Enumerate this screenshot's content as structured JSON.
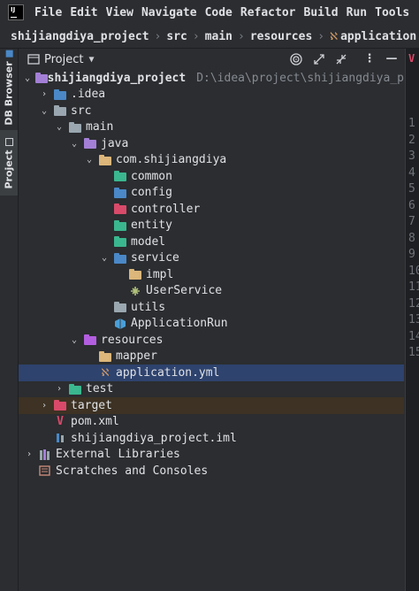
{
  "menu": [
    "File",
    "Edit",
    "View",
    "Navigate",
    "Code",
    "Refactor",
    "Build",
    "Run",
    "Tools"
  ],
  "breadcrumbs": [
    "shijiangdiya_project",
    "src",
    "main",
    "resources",
    "application.yml"
  ],
  "side_tabs": {
    "db_browser": "DB Browser",
    "project": "Project"
  },
  "panel": {
    "title": "Project"
  },
  "tree": {
    "root": "shijiangdiya_project",
    "root_path": "D:\\idea\\project\\shijiangdiya_p",
    "idea": ".idea",
    "src": "src",
    "main": "main",
    "java": "java",
    "package": "com.shijiangdiya",
    "common": "common",
    "config": "config",
    "controller": "controller",
    "entity": "entity",
    "model": "model",
    "service": "service",
    "impl": "impl",
    "user_service": "UserService",
    "utils": "utils",
    "application_run": "ApplicationRun",
    "resources": "resources",
    "mapper": "mapper",
    "application_yml": "application.yml",
    "test": "test",
    "target": "target",
    "pom": "pom.xml",
    "iml": "shijiangdiya_project.iml",
    "external_libraries": "External Libraries",
    "scratches": "Scratches and Consoles"
  },
  "gutter_lines": [
    "1",
    "2",
    "3",
    "4",
    "5",
    "6",
    "7",
    "8",
    "9",
    "10",
    "11",
    "12",
    "13",
    "14",
    "15"
  ],
  "colors": {
    "background": "#2b2d30",
    "selection": "#2e436e",
    "excluded": "#3d3223",
    "source_folder": "#4a88c7",
    "resources_folder": "#b35ee0",
    "test_folder": "#3ab78e",
    "package_folder": "#9aa7b0",
    "plain_folder": "#dcb67a",
    "accent_green": "#5fb865"
  }
}
